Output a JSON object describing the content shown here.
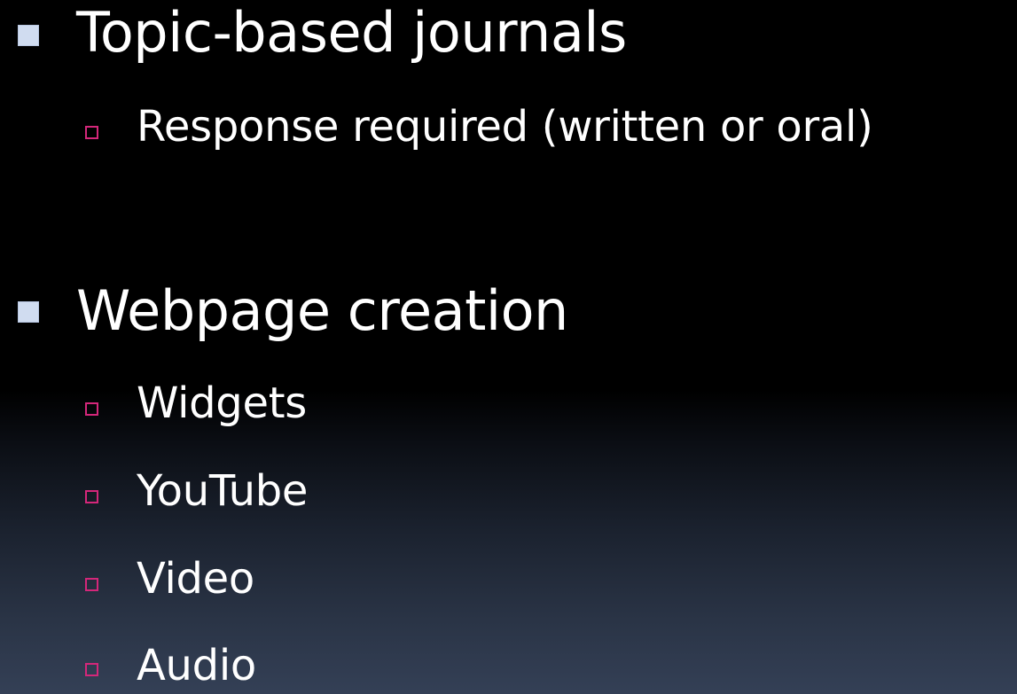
{
  "slide": {
    "bullets": [
      {
        "text": "Topic-based journals",
        "sub": [
          {
            "text": "Response required (written or oral)"
          }
        ]
      },
      {
        "text": "Webpage creation",
        "sub": [
          {
            "text": "Widgets"
          },
          {
            "text": "YouTube"
          },
          {
            "text": "Video"
          },
          {
            "text": "Audio"
          }
        ]
      }
    ]
  },
  "colors": {
    "level1_bullet": "#d0dcf0",
    "level2_bullet": "#d4277a",
    "text": "#ffffff",
    "background_top": "#000000",
    "background_bottom": "#344056"
  },
  "icons": {
    "level1": "filled-square-bullet-icon",
    "level2": "hollow-square-bullet-icon"
  }
}
